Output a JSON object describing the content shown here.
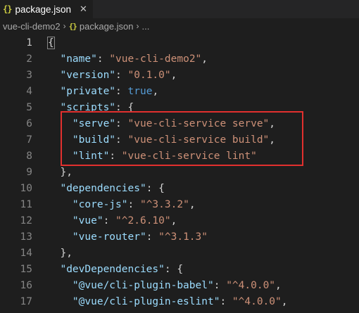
{
  "tab": {
    "icon": "{}",
    "icon_name": "json-braces-icon",
    "label": "package.json",
    "close": "✕"
  },
  "breadcrumb": {
    "folder": "vue-cli-demo2",
    "sep": "›",
    "file_icon": "{}",
    "file": "package.json",
    "ellipsis": "..."
  },
  "colors": {
    "background": "#1e1e1e",
    "key": "#9cdcfe",
    "string": "#ce9178",
    "boolean": "#569cd6",
    "highlight": "#e2302e"
  },
  "lines": [
    {
      "n": "1",
      "tokens": [
        {
          "t": "punc",
          "v": "{"
        }
      ]
    },
    {
      "n": "2",
      "tokens": [
        {
          "t": "punc",
          "v": "  "
        },
        {
          "t": "key",
          "v": "\"name\""
        },
        {
          "t": "punc",
          "v": ": "
        },
        {
          "t": "str",
          "v": "\"vue-cli-demo2\""
        },
        {
          "t": "punc",
          "v": ","
        }
      ]
    },
    {
      "n": "3",
      "tokens": [
        {
          "t": "punc",
          "v": "  "
        },
        {
          "t": "key",
          "v": "\"version\""
        },
        {
          "t": "punc",
          "v": ": "
        },
        {
          "t": "str",
          "v": "\"0.1.0\""
        },
        {
          "t": "punc",
          "v": ","
        }
      ]
    },
    {
      "n": "4",
      "tokens": [
        {
          "t": "punc",
          "v": "  "
        },
        {
          "t": "key",
          "v": "\"private\""
        },
        {
          "t": "punc",
          "v": ": "
        },
        {
          "t": "bool",
          "v": "true"
        },
        {
          "t": "punc",
          "v": ","
        }
      ]
    },
    {
      "n": "5",
      "tokens": [
        {
          "t": "punc",
          "v": "  "
        },
        {
          "t": "key",
          "v": "\"scripts\""
        },
        {
          "t": "punc",
          "v": ": {"
        }
      ]
    },
    {
      "n": "6",
      "tokens": [
        {
          "t": "punc",
          "v": "    "
        },
        {
          "t": "key",
          "v": "\"serve\""
        },
        {
          "t": "punc",
          "v": ": "
        },
        {
          "t": "str",
          "v": "\"vue-cli-service serve\""
        },
        {
          "t": "punc",
          "v": ","
        }
      ]
    },
    {
      "n": "7",
      "tokens": [
        {
          "t": "punc",
          "v": "    "
        },
        {
          "t": "key",
          "v": "\"build\""
        },
        {
          "t": "punc",
          "v": ": "
        },
        {
          "t": "str",
          "v": "\"vue-cli-service build\""
        },
        {
          "t": "punc",
          "v": ","
        }
      ]
    },
    {
      "n": "8",
      "tokens": [
        {
          "t": "punc",
          "v": "    "
        },
        {
          "t": "key",
          "v": "\"lint\""
        },
        {
          "t": "punc",
          "v": ": "
        },
        {
          "t": "str",
          "v": "\"vue-cli-service lint\""
        }
      ]
    },
    {
      "n": "9",
      "tokens": [
        {
          "t": "punc",
          "v": "  },"
        }
      ]
    },
    {
      "n": "10",
      "tokens": [
        {
          "t": "punc",
          "v": "  "
        },
        {
          "t": "key",
          "v": "\"dependencies\""
        },
        {
          "t": "punc",
          "v": ": {"
        }
      ]
    },
    {
      "n": "11",
      "tokens": [
        {
          "t": "punc",
          "v": "    "
        },
        {
          "t": "key",
          "v": "\"core-js\""
        },
        {
          "t": "punc",
          "v": ": "
        },
        {
          "t": "str",
          "v": "\"^3.3.2\""
        },
        {
          "t": "punc",
          "v": ","
        }
      ]
    },
    {
      "n": "12",
      "tokens": [
        {
          "t": "punc",
          "v": "    "
        },
        {
          "t": "key",
          "v": "\"vue\""
        },
        {
          "t": "punc",
          "v": ": "
        },
        {
          "t": "str",
          "v": "\"^2.6.10\""
        },
        {
          "t": "punc",
          "v": ","
        }
      ]
    },
    {
      "n": "13",
      "tokens": [
        {
          "t": "punc",
          "v": "    "
        },
        {
          "t": "key",
          "v": "\"vue-router\""
        },
        {
          "t": "punc",
          "v": ": "
        },
        {
          "t": "str",
          "v": "\"^3.1.3\""
        }
      ]
    },
    {
      "n": "14",
      "tokens": [
        {
          "t": "punc",
          "v": "  },"
        }
      ]
    },
    {
      "n": "15",
      "tokens": [
        {
          "t": "punc",
          "v": "  "
        },
        {
          "t": "key",
          "v": "\"devDependencies\""
        },
        {
          "t": "punc",
          "v": ": {"
        }
      ]
    },
    {
      "n": "16",
      "tokens": [
        {
          "t": "punc",
          "v": "    "
        },
        {
          "t": "key",
          "v": "\"@vue/cli-plugin-babel\""
        },
        {
          "t": "punc",
          "v": ": "
        },
        {
          "t": "str",
          "v": "\"^4.0.0\""
        },
        {
          "t": "punc",
          "v": ","
        }
      ]
    },
    {
      "n": "17",
      "tokens": [
        {
          "t": "punc",
          "v": "    "
        },
        {
          "t": "key",
          "v": "\"@vue/cli-plugin-eslint\""
        },
        {
          "t": "punc",
          "v": ": "
        },
        {
          "t": "str",
          "v": "\"^4.0.0\""
        },
        {
          "t": "punc",
          "v": ","
        }
      ]
    }
  ]
}
